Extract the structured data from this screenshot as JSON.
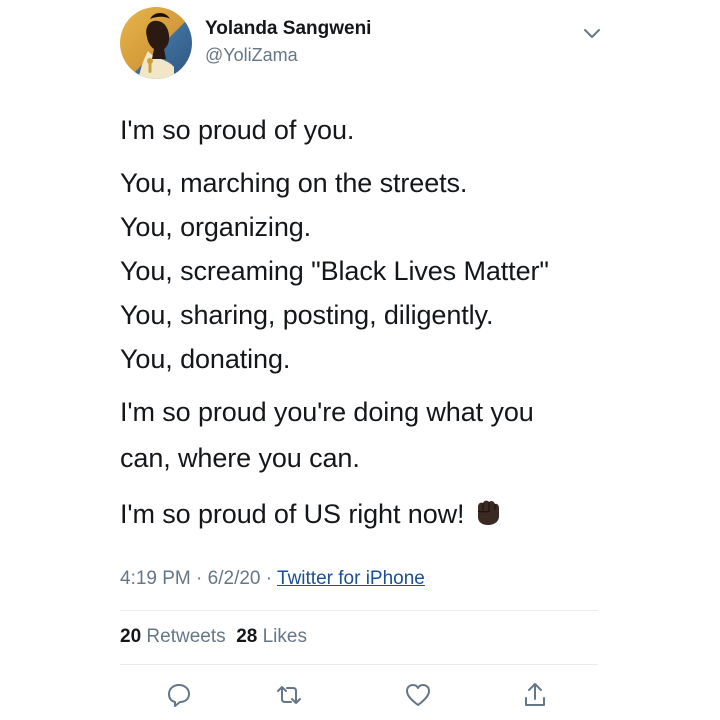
{
  "author": {
    "name": "Yolanda Sangweni",
    "handle": "@YoliZama"
  },
  "tweet": {
    "lines": [
      "I'm so proud of you.",
      "You, marching on the streets.",
      "You, organizing.",
      "You, screaming \"Black Lives Matter\"",
      "You, sharing, posting, diligently.",
      "You, donating.",
      "I'm so proud you're doing what you",
      "can, where you can.",
      "I'm so proud of US right now!"
    ],
    "emoji": "raised-fist-dark-skin"
  },
  "meta": {
    "time": "4:19 PM",
    "separator": "·",
    "date": "6/2/20",
    "source": "Twitter for iPhone"
  },
  "stats": {
    "retweets_count": "20",
    "retweets_label": "Retweets",
    "likes_count": "28",
    "likes_label": "Likes"
  },
  "icons": {
    "more": "chevron-down-icon",
    "reply": "reply-icon",
    "retweet": "retweet-icon",
    "like": "heart-icon",
    "share": "share-icon"
  },
  "colors": {
    "text": "#14171a",
    "secondary": "#657786",
    "link": "#1b4f94",
    "divider": "#e6ecf0"
  }
}
